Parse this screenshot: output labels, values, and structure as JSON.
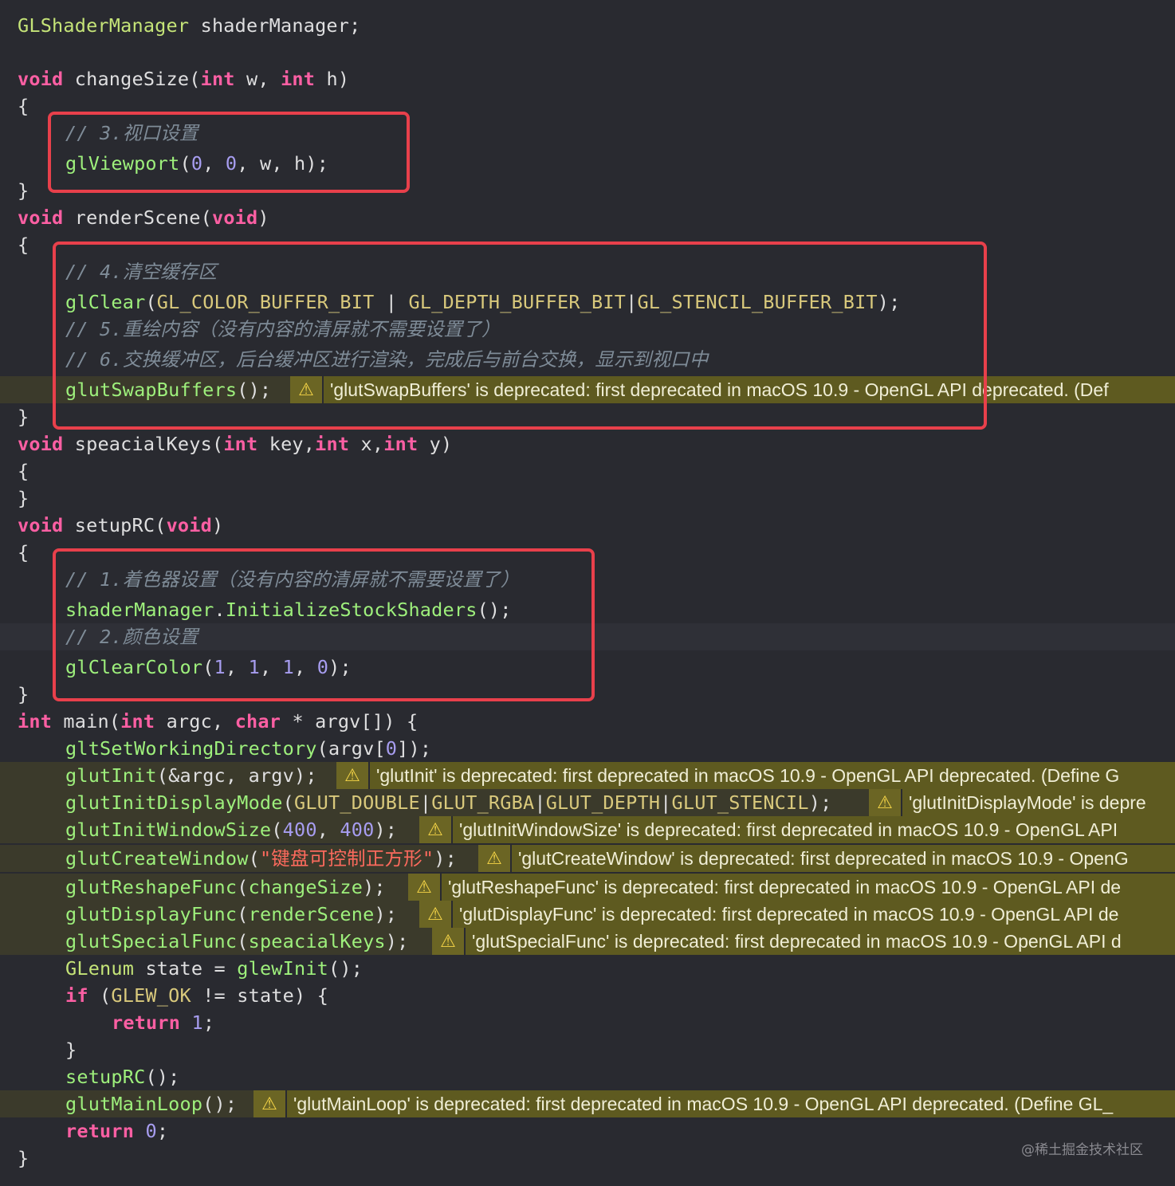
{
  "lines": [
    {
      "text": "GLShaderManager shaderManager;"
    },
    {
      "text": "void changeSize(int w, int h)"
    },
    {
      "text": "{"
    },
    {
      "text": "// 3.视口设置"
    },
    {
      "text": "glViewport(0, 0, w, h);"
    },
    {
      "text": "}"
    },
    {
      "text": "void renderScene(void)"
    },
    {
      "text": "{"
    },
    {
      "text": "// 4.清空缓存区"
    },
    {
      "text": "glClear(GL_COLOR_BUFFER_BIT | GL_DEPTH_BUFFER_BIT|GL_STENCIL_BUFFER_BIT);"
    },
    {
      "text": "// 5.重绘内容（没有内容的清屏就不需要设置了）"
    },
    {
      "text": "// 6.交换缓冲区，后台缓冲区进行渲染，完成后与前台交换，显示到视口中"
    },
    {
      "text": "glutSwapBuffers();"
    },
    {
      "text": "}"
    },
    {
      "text": "void speacialKeys(int key,int x,int y)"
    },
    {
      "text": "{"
    },
    {
      "text": "}"
    },
    {
      "text": "void setupRC(void)"
    },
    {
      "text": "{"
    },
    {
      "text": "// 1.着色器设置（没有内容的清屏就不需要设置了）"
    },
    {
      "text": "shaderManager.InitializeStockShaders();"
    },
    {
      "text": "// 2.颜色设置"
    },
    {
      "text": "glClearColor(1, 1, 1, 0);"
    },
    {
      "text": "}"
    },
    {
      "text": "int main(int argc, char * argv[]) {"
    },
    {
      "text": "gltSetWorkingDirectory(argv[0]);"
    },
    {
      "text": "glutInit(&argc, argv);"
    },
    {
      "text": "glutInitDisplayMode(GLUT_DOUBLE|GLUT_RGBA|GLUT_DEPTH|GLUT_STENCIL);"
    },
    {
      "text": "glutInitWindowSize(400, 400);"
    },
    {
      "text": "glutCreateWindow(\"键盘可控制正方形\");"
    },
    {
      "text": "glutReshapeFunc(changeSize);"
    },
    {
      "text": "glutDisplayFunc(renderScene);"
    },
    {
      "text": "glutSpecialFunc(speacialKeys);"
    },
    {
      "text": "GLenum state = glewInit();"
    },
    {
      "text": "if (GLEW_OK != state) {"
    },
    {
      "text": "return 1;"
    },
    {
      "text": "}"
    },
    {
      "text": "setupRC();"
    },
    {
      "text": "glutMainLoop();"
    },
    {
      "text": "return 0;"
    },
    {
      "text": "}"
    }
  ],
  "warnings": [
    {
      "text": "'glutSwapBuffers' is deprecated: first deprecated in macOS 10.9 - OpenGL API deprecated. (Def"
    },
    {
      "text": "'glutInit' is deprecated: first deprecated in macOS 10.9 - OpenGL API deprecated. (Define G"
    },
    {
      "text": "'glutInitDisplayMode' is depre"
    },
    {
      "text": "'glutInitWindowSize' is deprecated: first deprecated in macOS 10.9 - OpenGL API"
    },
    {
      "text": "'glutCreateWindow' is deprecated: first deprecated in macOS 10.9 - OpenG"
    },
    {
      "text": "'glutReshapeFunc' is deprecated: first deprecated in macOS 10.9 - OpenGL API de"
    },
    {
      "text": "'glutDisplayFunc' is deprecated: first deprecated in macOS 10.9 - OpenGL API de"
    },
    {
      "text": "'glutSpecialFunc' is deprecated: first deprecated in macOS 10.9 - OpenGL API d"
    },
    {
      "text": "'glutMainLoop' is deprecated: first deprecated in macOS 10.9 - OpenGL API deprecated. (Define GL_"
    }
  ],
  "warning_icon": "warning-triangle-icon",
  "watermark": "@稀土掘金技术社区",
  "colors": {
    "background": "#292a30",
    "keyword": "#fc5fa3",
    "comment": "#7f8c98",
    "warning_bar": "#5e5a20",
    "highlight_box": "#e8404b"
  }
}
